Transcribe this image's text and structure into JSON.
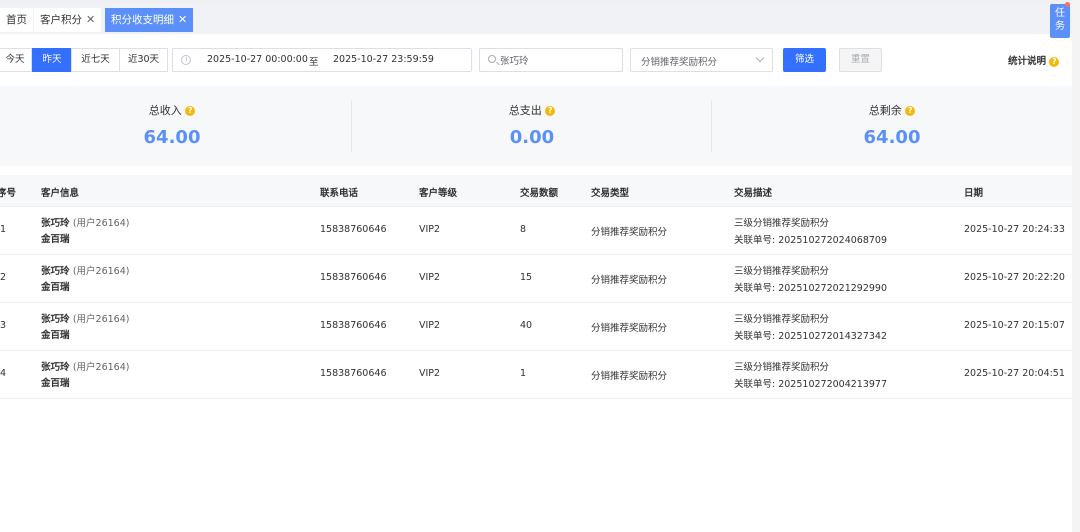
{
  "tabs": [
    {
      "label": "首页",
      "closable": false,
      "active": false
    },
    {
      "label": "客户积分",
      "closable": true,
      "active": false
    },
    {
      "label": "积分收支明细",
      "closable": true,
      "active": true
    }
  ],
  "task_button": {
    "line1": "任",
    "line2": "务"
  },
  "filters": {
    "quick_ranges": [
      "今天",
      "昨天",
      "近七天",
      "近30天"
    ],
    "active_range": "昨天",
    "date_start": "2025-10-27 00:00:00",
    "date_sep": "至",
    "date_end": "2025-10-27 23:59:59",
    "search_value": "张巧玲",
    "type_select": "分销推荐奖励积分",
    "filter_button": "筛选",
    "reset_button": "重置",
    "stat_link": "统计说明"
  },
  "summary": [
    {
      "label": "总收入",
      "value": "64.00"
    },
    {
      "label": "总支出",
      "value": "0.00"
    },
    {
      "label": "总剩余",
      "value": "64.00"
    }
  ],
  "table": {
    "columns": [
      "序号",
      "客户信息",
      "联系电话",
      "客户等级",
      "交易数额",
      "交易类型",
      "交易描述",
      "日期"
    ],
    "rows": [
      {
        "index": "1",
        "name": "张巧玲",
        "uid": "(用户26164)",
        "store": "金百瑞",
        "phone": "15838760646",
        "level": "VIP2",
        "amount": "8",
        "type": "分销推荐奖励积分",
        "desc": "三级分销推荐奖励积分",
        "order": "关联单号: 202510272024068709",
        "date": "2025-10-27 20:24:33"
      },
      {
        "index": "2",
        "name": "张巧玲",
        "uid": "(用户26164)",
        "store": "金百瑞",
        "phone": "15838760646",
        "level": "VIP2",
        "amount": "15",
        "type": "分销推荐奖励积分",
        "desc": "三级分销推荐奖励积分",
        "order": "关联单号: 202510272021292990",
        "date": "2025-10-27 20:22:20"
      },
      {
        "index": "3",
        "name": "张巧玲",
        "uid": "(用户26164)",
        "store": "金百瑞",
        "phone": "15838760646",
        "level": "VIP2",
        "amount": "40",
        "type": "分销推荐奖励积分",
        "desc": "三级分销推荐奖励积分",
        "order": "关联单号: 202510272014327342",
        "date": "2025-10-27 20:15:07"
      },
      {
        "index": "4",
        "name": "张巧玲",
        "uid": "(用户26164)",
        "store": "金百瑞",
        "phone": "15838760646",
        "level": "VIP2",
        "amount": "1",
        "type": "分销推荐奖励积分",
        "desc": "三级分销推荐奖励积分",
        "order": "关联单号: 202510272004213977",
        "date": "2025-10-27 20:04:51"
      }
    ]
  },
  "colors": {
    "accent": "#3370ff",
    "tab_active": "#5b8ff9",
    "summary_value": "#5b8ff9",
    "help_icon": "#f5b80f"
  }
}
